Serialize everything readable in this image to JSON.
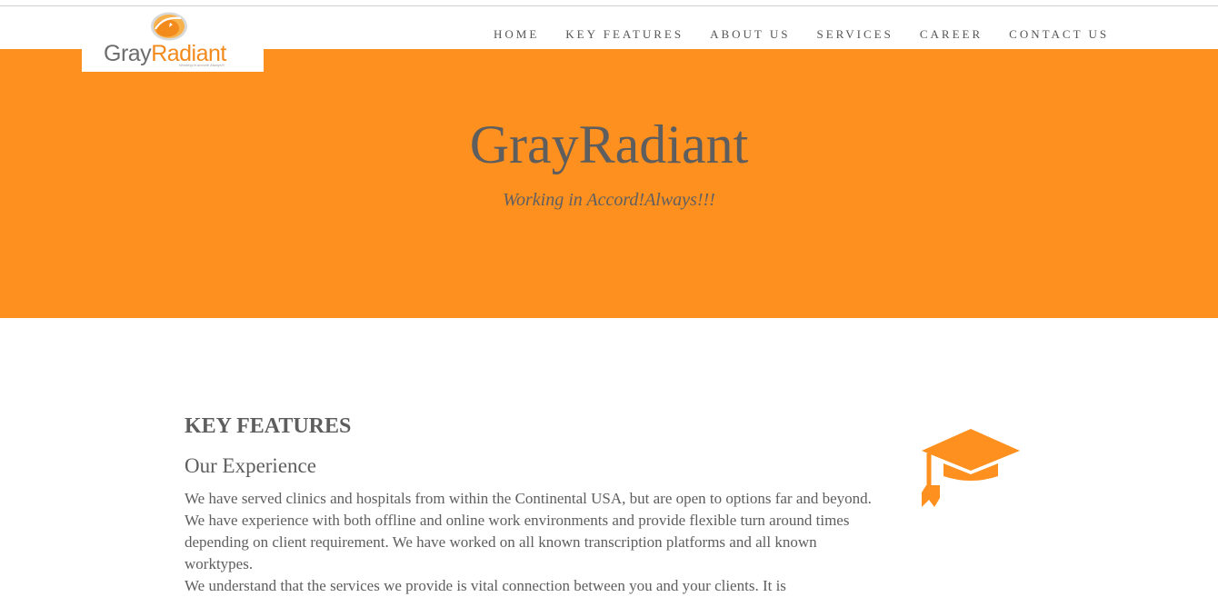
{
  "brand": {
    "logo_part1": "Gray",
    "logo_part2": "Radiant",
    "logo_tagline": "Working in accord! Always!!!"
  },
  "nav": {
    "items": [
      {
        "label": "HOME"
      },
      {
        "label": "KEY FEATURES"
      },
      {
        "label": "ABOUT US"
      },
      {
        "label": "SERVICES"
      },
      {
        "label": "CAREER"
      },
      {
        "label": "CONTACT US"
      }
    ]
  },
  "hero": {
    "title": "GrayRadiant",
    "subtitle": "Working in Accord!Always!!!",
    "background": "#fe9020"
  },
  "features": {
    "heading": "KEY FEATURES",
    "subheading": "Our Experience",
    "lines": [
      "We have served clinics and hospitals from within the Continental USA, but are open to options far and beyond.",
      "We have experience with both offline and online work environments and provide flexible turn around times",
      "depending on client requirement. We have worked on all known transcription platforms and all known",
      "worktypes.",
      "We understand that the services we provide is vital connection between you and your clients. It is"
    ],
    "icon": "graduation-cap-icon",
    "icon_color": "#fe9020"
  }
}
